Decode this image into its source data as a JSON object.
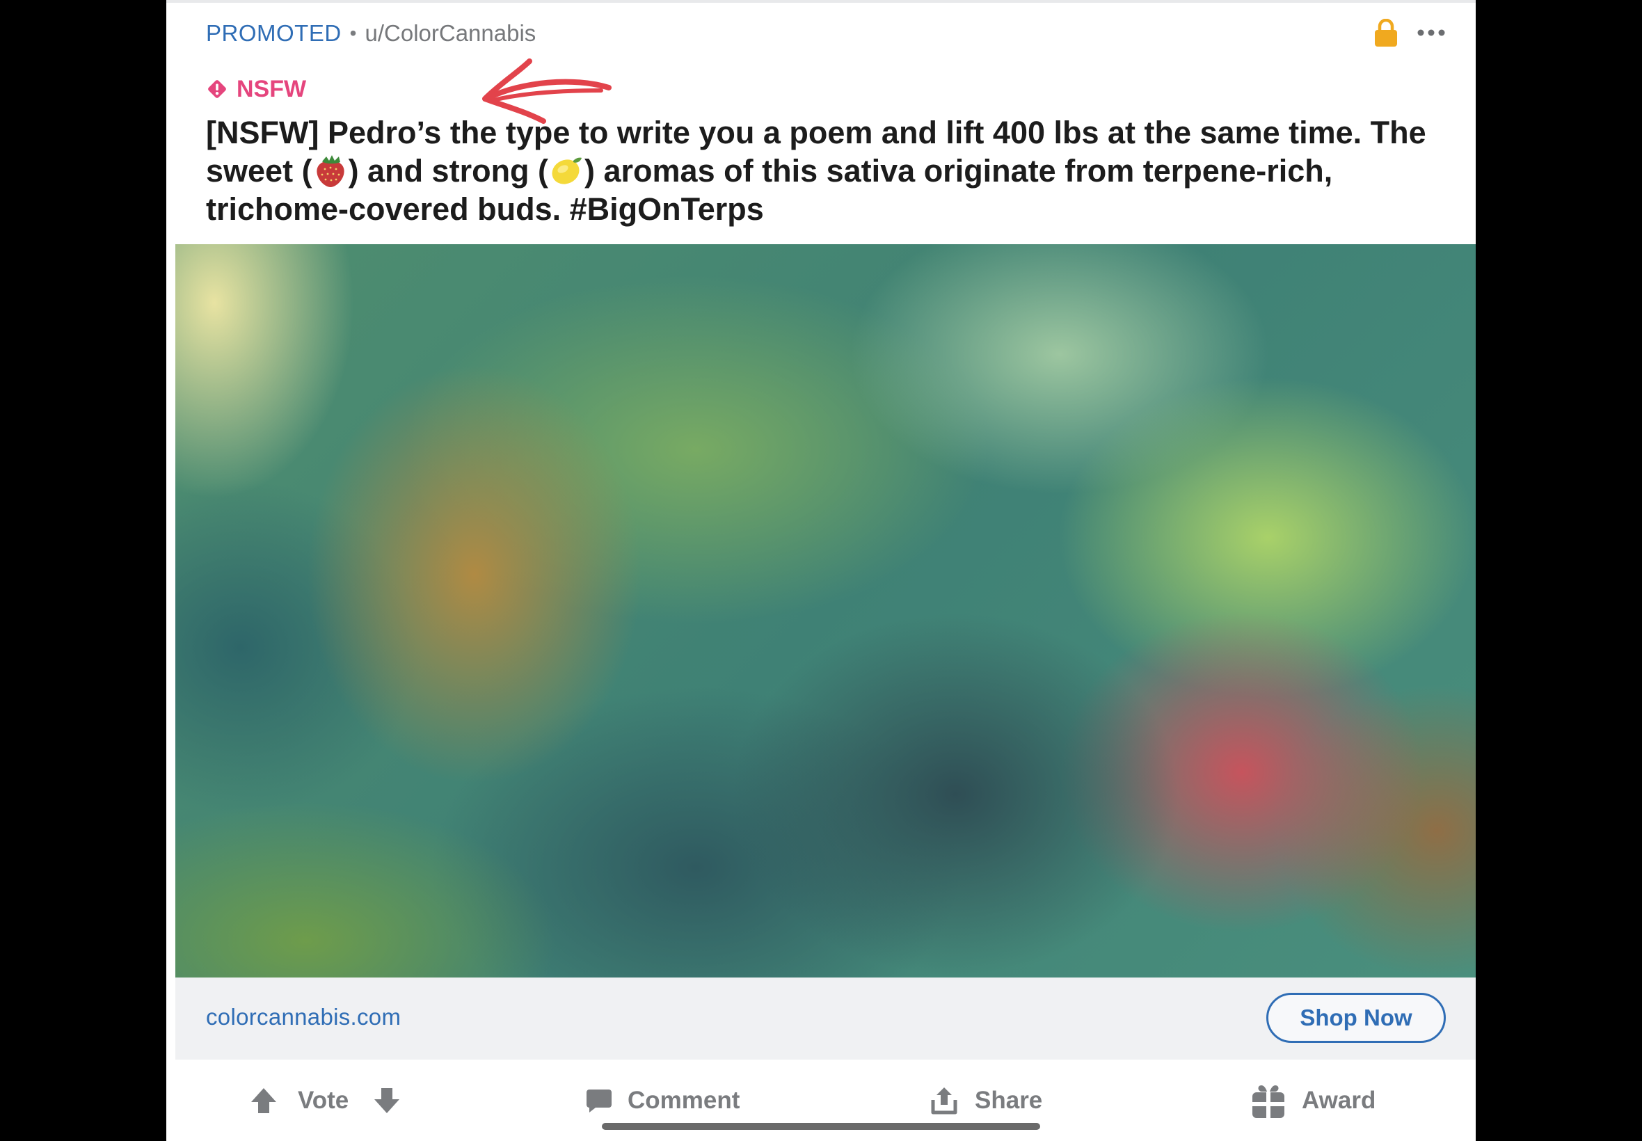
{
  "post": {
    "promoted_label": "PROMOTED",
    "separator": "•",
    "author": "u/ColorCannabis",
    "nsfw_label": "NSFW",
    "title_part1": "[NSFW] Pedro’s the type to write you a poem and lift 400 lbs at the same time. The sweet (",
    "title_part2": ") and strong (",
    "title_part3": ") aromas of this sativa originate from terpene-rich, trichome-covered buds. #BigOnTerps",
    "emoji_1": "strawberry-emoji",
    "emoji_2": "lemon-emoji"
  },
  "ad": {
    "domain": "colorcannabis.com",
    "cta_label": "Shop Now"
  },
  "actions": {
    "vote_label": "Vote",
    "comment_label": "Comment",
    "share_label": "Share",
    "award_label": "Award"
  },
  "icons": {
    "lock": "lock-icon",
    "more": "more-options-icon",
    "nsfw": "nsfw-diamond-icon",
    "upvote": "upvote-arrow-icon",
    "downvote": "downvote-arrow-icon",
    "comment": "comment-bubble-icon",
    "share": "share-icon",
    "award": "gift-icon"
  },
  "colors": {
    "accent_blue": "#2f6db5",
    "nsfw_pink": "#e5457d",
    "lock_orange": "#f0a91f",
    "annotation_red": "#e2434b",
    "icon_gray": "#7a7c7f"
  }
}
